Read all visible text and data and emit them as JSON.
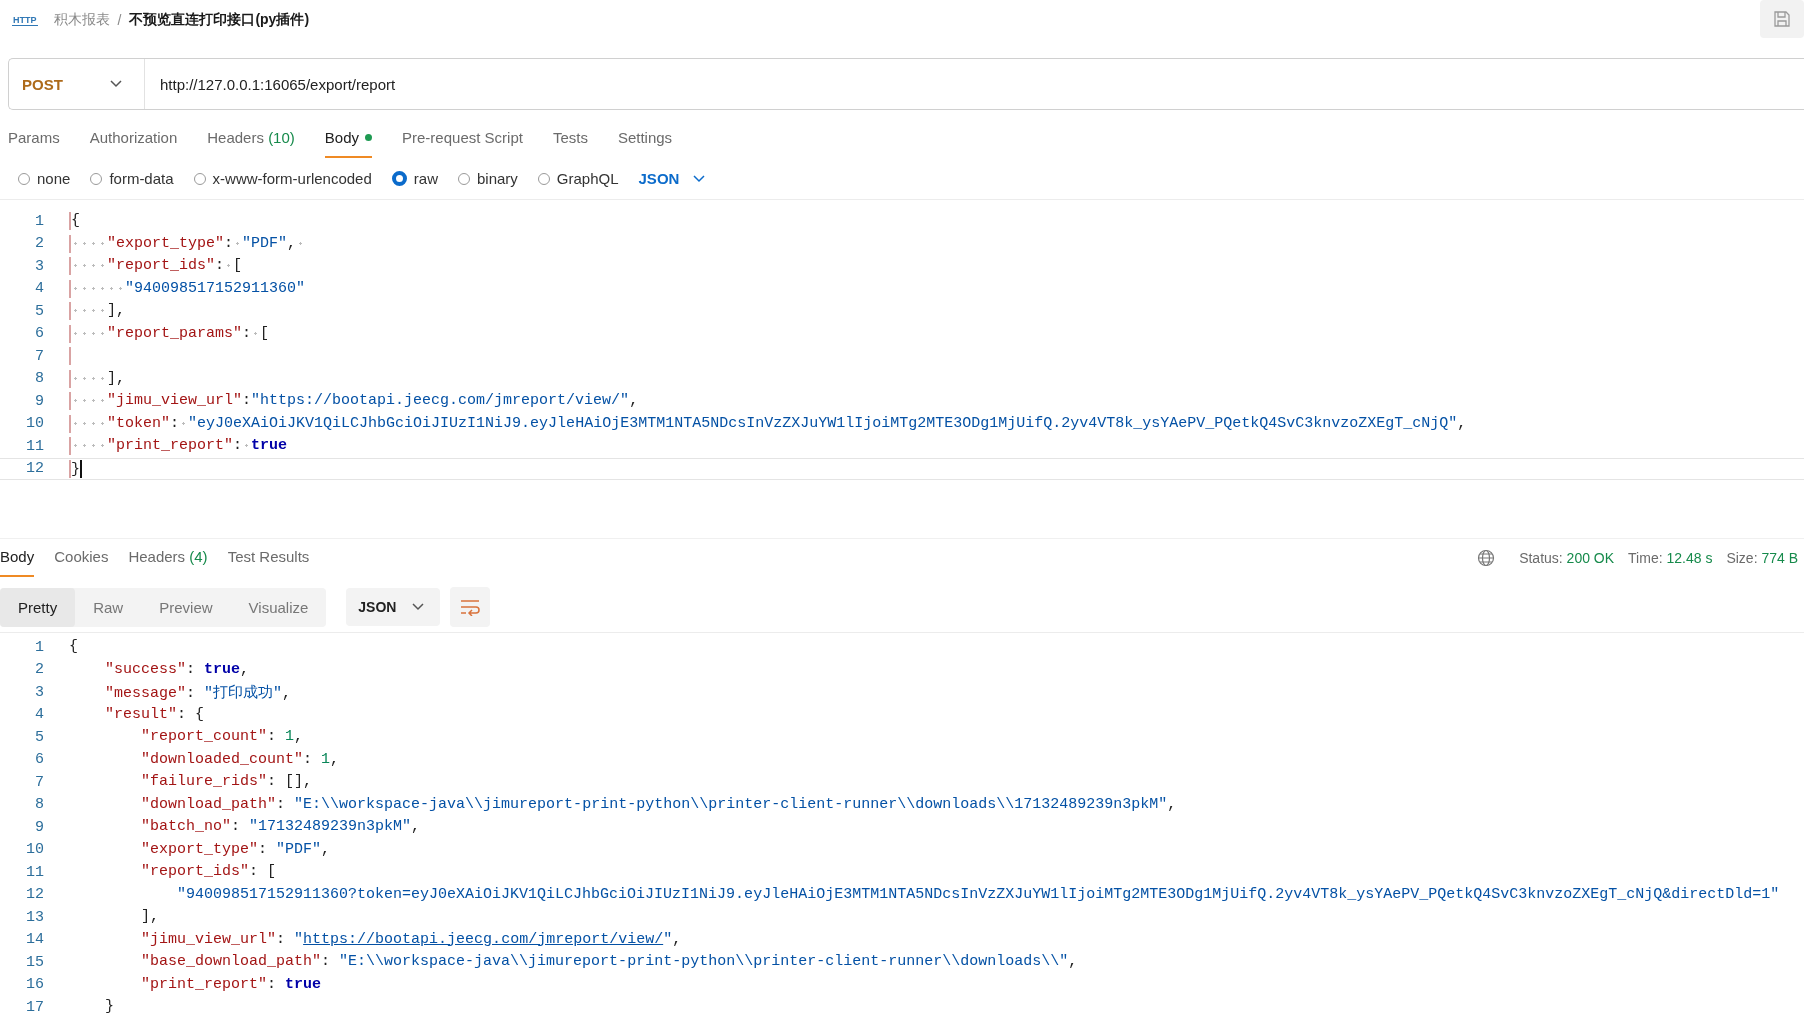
{
  "breadcrumb": {
    "icon_label": "HTTP",
    "parent": "积木报表",
    "separator": "/",
    "title": "不预览直连打印接口(py插件)"
  },
  "request": {
    "method": "POST",
    "url": "http://127.0.0.1:16065/export/report"
  },
  "request_tabs": [
    {
      "label": "Params",
      "selected": false
    },
    {
      "label": "Authorization",
      "selected": false
    },
    {
      "label": "Headers",
      "count": "(10)",
      "selected": false
    },
    {
      "label": "Body",
      "dot": true,
      "selected": true
    },
    {
      "label": "Pre-request Script",
      "selected": false
    },
    {
      "label": "Tests",
      "selected": false
    },
    {
      "label": "Settings",
      "selected": false
    }
  ],
  "body_types": [
    {
      "label": "none",
      "selected": false
    },
    {
      "label": "form-data",
      "selected": false
    },
    {
      "label": "x-www-form-urlencoded",
      "selected": false
    },
    {
      "label": "raw",
      "selected": true
    },
    {
      "label": "binary",
      "selected": false
    },
    {
      "label": "GraphQL",
      "selected": false
    }
  ],
  "body_format": "JSON",
  "request_editor": {
    "show_whitespace": true,
    "lines": [
      {
        "n": "1",
        "active": false,
        "tokens": [
          {
            "kind": "punct",
            "t": "{"
          }
        ]
      },
      {
        "n": "2",
        "active": false,
        "tokens": [
          {
            "kind": "key",
            "t": "    \"export_type\""
          },
          {
            "kind": "punct",
            "t": ": "
          },
          {
            "kind": "string",
            "t": "\"PDF\""
          },
          {
            "kind": "punct",
            "t": ", "
          }
        ]
      },
      {
        "n": "3",
        "active": false,
        "tokens": [
          {
            "kind": "key",
            "t": "    \"report_ids\""
          },
          {
            "kind": "punct",
            "t": ": ["
          }
        ]
      },
      {
        "n": "4",
        "active": false,
        "tokens": [
          {
            "kind": "string",
            "t": "      \"940098517152911360\""
          }
        ]
      },
      {
        "n": "5",
        "active": false,
        "tokens": [
          {
            "kind": "punct",
            "t": "    ],"
          }
        ]
      },
      {
        "n": "6",
        "active": false,
        "tokens": [
          {
            "kind": "key",
            "t": "    \"report_params\""
          },
          {
            "kind": "punct",
            "t": ": ["
          }
        ]
      },
      {
        "n": "7",
        "active": false
      },
      {
        "n": "8",
        "active": false,
        "tokens": [
          {
            "kind": "punct",
            "t": "    ],"
          }
        ]
      },
      {
        "n": "9",
        "active": false,
        "tokens": [
          {
            "kind": "key",
            "t": "    \"jimu_view_url\""
          },
          {
            "kind": "punct",
            "t": ":"
          },
          {
            "kind": "string",
            "t": "\"https://bootapi.jeecg.com/jmreport/view/\""
          },
          {
            "kind": "punct",
            "t": ","
          }
        ]
      },
      {
        "n": "10",
        "active": false,
        "tokens": [
          {
            "kind": "key",
            "t": "    \"token\""
          },
          {
            "kind": "punct",
            "t": ": "
          },
          {
            "kind": "string",
            "t": "\"eyJ0eXAiOiJKV1QiLCJhbGciOiJIUzI1NiJ9.eyJleHAiOjE3MTM1NTA5NDcsInVzZXJuYW1lIjoiMTg2MTE3ODg1MjUifQ.2yv4VT8k_ysYAePV_PQetkQ4SvC3knvzoZXEgT_cNjQ\""
          },
          {
            "kind": "punct",
            "t": ","
          }
        ]
      },
      {
        "n": "11",
        "active": false,
        "tokens": [
          {
            "kind": "key",
            "t": "    \"print_report\""
          },
          {
            "kind": "punct",
            "t": ": "
          },
          {
            "kind": "bool",
            "t": "true"
          }
        ]
      },
      {
        "n": "12",
        "active": true,
        "tokens": [
          {
            "kind": "punct",
            "t": "}"
          }
        ]
      }
    ]
  },
  "response_tabs": [
    {
      "label": "Body",
      "selected": true
    },
    {
      "label": "Cookies",
      "selected": false
    },
    {
      "label": "Headers",
      "count": "(4)",
      "selected": false
    },
    {
      "label": "Test Results",
      "selected": false
    }
  ],
  "response_stats": [
    {
      "label": "Status:",
      "value": "200 OK"
    },
    {
      "label": "Time:",
      "value": "12.48 s"
    },
    {
      "label": "Size:",
      "value": "774 B"
    }
  ],
  "view_modes": [
    {
      "label": "Pretty",
      "selected": true
    },
    {
      "label": "Raw",
      "selected": false
    },
    {
      "label": "Preview",
      "selected": false
    },
    {
      "label": "Visualize",
      "selected": false
    }
  ],
  "response_format": "JSON",
  "response_editor": {
    "show_whitespace": false,
    "lines": [
      {
        "n": "1",
        "tokens": [
          {
            "kind": "punct",
            "t": "{"
          }
        ]
      },
      {
        "n": "2",
        "tokens": [
          {
            "kind": "key",
            "t": "    \"success\""
          },
          {
            "kind": "punct",
            "t": ": "
          },
          {
            "kind": "bool",
            "t": "true"
          },
          {
            "kind": "punct",
            "t": ","
          }
        ]
      },
      {
        "n": "3",
        "tokens": [
          {
            "kind": "key",
            "t": "    \"message\""
          },
          {
            "kind": "punct",
            "t": ": "
          },
          {
            "kind": "string",
            "t": "\"打印成功\""
          },
          {
            "kind": "punct",
            "t": ","
          }
        ]
      },
      {
        "n": "4",
        "tokens": [
          {
            "kind": "key",
            "t": "    \"result\""
          },
          {
            "kind": "punct",
            "t": ": {"
          }
        ]
      },
      {
        "n": "5",
        "tokens": [
          {
            "kind": "key",
            "t": "        \"report_count\""
          },
          {
            "kind": "punct",
            "t": ": "
          },
          {
            "kind": "number",
            "t": "1"
          },
          {
            "kind": "punct",
            "t": ","
          }
        ]
      },
      {
        "n": "6",
        "tokens": [
          {
            "kind": "key",
            "t": "        \"downloaded_count\""
          },
          {
            "kind": "punct",
            "t": ": "
          },
          {
            "kind": "number",
            "t": "1"
          },
          {
            "kind": "punct",
            "t": ","
          }
        ]
      },
      {
        "n": "7",
        "tokens": [
          {
            "kind": "key",
            "t": "        \"failure_rids\""
          },
          {
            "kind": "punct",
            "t": ": [],"
          }
        ]
      },
      {
        "n": "8",
        "tokens": [
          {
            "kind": "key",
            "t": "        \"download_path\""
          },
          {
            "kind": "punct",
            "t": ": "
          },
          {
            "kind": "string",
            "t": "\"E:\\\\workspace-java\\\\jimureport-print-python\\\\printer-client-runner\\\\downloads\\\\17132489239n3pkM\""
          },
          {
            "kind": "punct",
            "t": ","
          }
        ]
      },
      {
        "n": "9",
        "tokens": [
          {
            "kind": "key",
            "t": "        \"batch_no\""
          },
          {
            "kind": "punct",
            "t": ": "
          },
          {
            "kind": "string",
            "t": "\"17132489239n3pkM\""
          },
          {
            "kind": "punct",
            "t": ","
          }
        ]
      },
      {
        "n": "10",
        "tokens": [
          {
            "kind": "key",
            "t": "        \"export_type\""
          },
          {
            "kind": "punct",
            "t": ": "
          },
          {
            "kind": "string",
            "t": "\"PDF\""
          },
          {
            "kind": "punct",
            "t": ","
          }
        ]
      },
      {
        "n": "11",
        "tokens": [
          {
            "kind": "key",
            "t": "        \"report_ids\""
          },
          {
            "kind": "punct",
            "t": ": ["
          }
        ]
      },
      {
        "n": "12",
        "tokens": [
          {
            "kind": "string",
            "t": "            \"940098517152911360?token=eyJ0eXAiOiJKV1QiLCJhbGciOiJIUzI1NiJ9.eyJleHAiOjE3MTM1NTA5NDcsInVzZXJuYW1lIjoiMTg2MTE3ODg1MjUifQ.2yv4VT8k_ysYAePV_PQetkQ4SvC3knvzoZXEgT_cNjQ&directDld=1\""
          }
        ]
      },
      {
        "n": "13",
        "tokens": [
          {
            "kind": "punct",
            "t": "        ],"
          }
        ]
      },
      {
        "n": "14",
        "tokens": [
          {
            "kind": "key",
            "t": "        \"jimu_view_url\""
          },
          {
            "kind": "punct",
            "t": ": "
          },
          {
            "kind": "string",
            "t": "\""
          },
          {
            "kind": "link",
            "t": "https://bootapi.jeecg.com/jmreport/view/"
          },
          {
            "kind": "string",
            "t": "\""
          },
          {
            "kind": "punct",
            "t": ","
          }
        ]
      },
      {
        "n": "15",
        "tokens": [
          {
            "kind": "key",
            "t": "        \"base_download_path\""
          },
          {
            "kind": "punct",
            "t": ": "
          },
          {
            "kind": "string",
            "t": "\"E:\\\\workspace-java\\\\jimureport-print-python\\\\printer-client-runner\\\\downloads\\\\\""
          },
          {
            "kind": "punct",
            "t": ","
          }
        ]
      },
      {
        "n": "16",
        "tokens": [
          {
            "kind": "key",
            "t": "        \"print_report\""
          },
          {
            "kind": "punct",
            "t": ": "
          },
          {
            "kind": "bool",
            "t": "true"
          }
        ]
      },
      {
        "n": "17",
        "tokens": [
          {
            "kind": "punct",
            "t": "    }"
          }
        ]
      }
    ]
  }
}
